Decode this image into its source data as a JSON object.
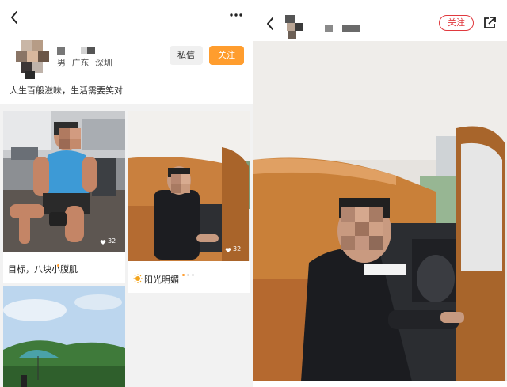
{
  "profile": {
    "gender": "男",
    "location_province": "广东",
    "location_city": "深圳",
    "bio": "人生百般滋味，生活需要笑对",
    "message_label": "私信",
    "follow_label": "关注"
  },
  "feed": [
    {
      "caption": "目标，八块小腹肌",
      "likes": "32"
    },
    {
      "caption": "阳光明媚",
      "likes": "32"
    }
  ],
  "detail": {
    "follow_label": "关注"
  },
  "colors": {
    "accent_orange": "#ff9d2e",
    "follow_red": "#e0393e"
  }
}
